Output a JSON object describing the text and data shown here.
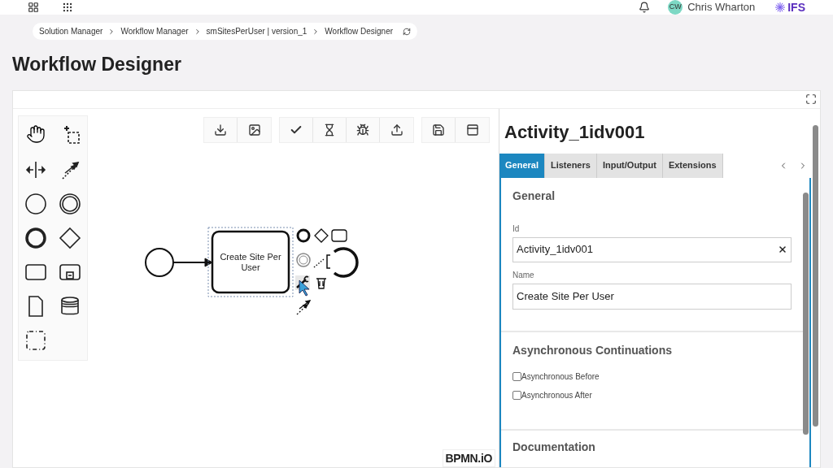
{
  "header": {
    "user_initials": "CW",
    "user_name": "Chris Wharton",
    "brand": "IFS"
  },
  "breadcrumb": [
    "Solution Manager",
    "Workflow Manager",
    "smSitesPerUser | version_1",
    "Workflow Designer"
  ],
  "page_title": "Workflow Designer",
  "diagram": {
    "task_label": "Create Site Per User",
    "logo": "BPMN.iO"
  },
  "properties": {
    "title": "Activity_1idv001",
    "tabs": [
      {
        "label": "General",
        "selected": true
      },
      {
        "label": "Listeners",
        "selected": false
      },
      {
        "label": "Input/Output",
        "selected": false
      },
      {
        "label": "Extensions",
        "selected": false
      }
    ],
    "general": {
      "title": "General",
      "fields": [
        {
          "label": "Id",
          "value": "Activity_1idv001",
          "kind": "input"
        },
        {
          "label": "Name",
          "value": "Create Site Per User",
          "kind": "textarea"
        }
      ]
    },
    "async": {
      "title": "Asynchronous Continuations",
      "options": [
        {
          "label": "Asynchronous Before",
          "checked": false
        },
        {
          "label": "Asynchronous After",
          "checked": false
        }
      ]
    },
    "documentation": {
      "title": "Documentation"
    }
  }
}
